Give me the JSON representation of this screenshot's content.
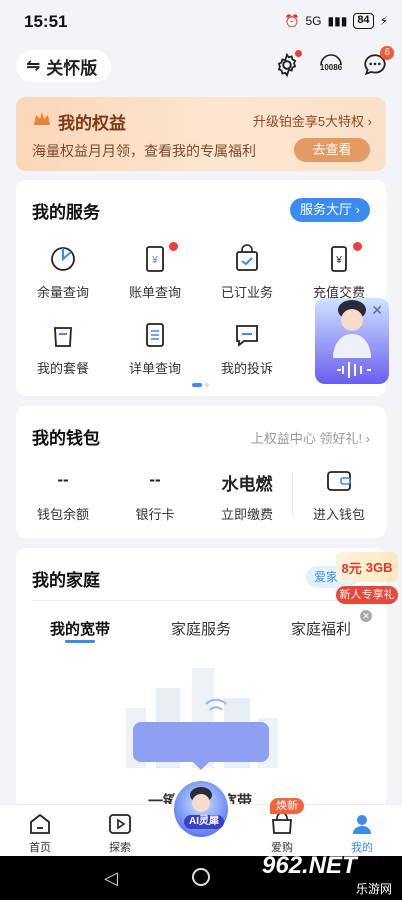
{
  "status": {
    "time": "15:51",
    "network": "5G",
    "battery": "84"
  },
  "topbar": {
    "care_label": "关怀版",
    "msg_badge": "6",
    "phone_label": "10086"
  },
  "benefits": {
    "title": "我的权益",
    "upgrade": "升级铂金享5大特权 ›",
    "subtitle": "海量权益月月领，查看我的专属福利",
    "button": "去查看"
  },
  "services": {
    "title": "我的服务",
    "hall": "服务大厅 ›",
    "items": [
      {
        "label": "余量查询"
      },
      {
        "label": "账单查询"
      },
      {
        "label": "已订业务"
      },
      {
        "label": "充值交费"
      },
      {
        "label": "我的套餐"
      },
      {
        "label": "详单查询"
      },
      {
        "label": "我的投诉"
      }
    ]
  },
  "wallet": {
    "title": "我的钱包",
    "link": "上权益中心 领好礼! ›",
    "items": [
      {
        "value": "--",
        "label": "钱包余额"
      },
      {
        "value": "--",
        "label": "银行卡"
      },
      {
        "value": "水电燃",
        "label": "立即缴费"
      },
      {
        "value": "",
        "label": "进入钱包"
      }
    ]
  },
  "family": {
    "title": "我的家庭",
    "tag": "爱家专",
    "tabs": [
      "我的宽带",
      "家庭服务",
      "家庭福利"
    ],
    "bb_left": "一键",
    "bb_right": "宽带"
  },
  "newbie": {
    "amount": "8元",
    "data": "3GB",
    "label": "新人专享礼"
  },
  "bottomnav": {
    "items": [
      {
        "label": "首页"
      },
      {
        "label": "探索"
      },
      {
        "label": "爱购"
      },
      {
        "label": "我的"
      }
    ],
    "ai_label": "AI灵犀",
    "new_badge": "焕新"
  },
  "watermark": {
    "brand": "962.NET",
    "sub": "乐游网"
  },
  "colors": {
    "accent": "#3c8cf0",
    "benefit_bg": "#fbd6b7",
    "alert": "#f03b3b"
  }
}
